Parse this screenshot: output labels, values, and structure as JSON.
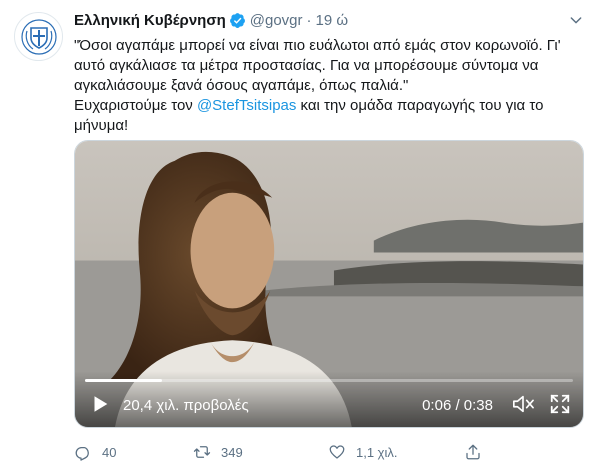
{
  "tweet": {
    "display_name": "Ελληνική Κυβέρνηση",
    "handle": "@govgr",
    "separator": "·",
    "time": "19 ώ",
    "text_before": "\"Όσοι αγαπάμε μπορεί να είναι πιο ευάλωτοι από εμάς στον κορωνοϊό. Γι' αυτό αγκάλιασε τα μέτρα προστασίας. Για να μπορέσουμε σύντομα να αγκαλιάσουμε ξανά όσους αγαπάμε, όπως παλιά.\"\nΕυχαριστούμε τον ",
    "mention": "@StefTsitsipas",
    "text_after": " και την ομάδα παραγωγής του για το μήνυμα!"
  },
  "video": {
    "views": "20,4 χιλ. προβολές",
    "time_readout": "0:06 / 0:38",
    "progress_fraction": 0.158
  },
  "actions": {
    "replies": "40",
    "retweets": "349",
    "likes": "1,1 χιλ."
  },
  "colors": {
    "accent": "#1b95e0",
    "verified": "#1da1f2",
    "muted": "#5b7083"
  },
  "icons": [
    "coat-of-arms-icon",
    "verified-icon",
    "chevron-down-icon",
    "play-icon",
    "mute-icon",
    "fullscreen-icon",
    "reply-icon",
    "retweet-icon",
    "like-icon",
    "share-icon"
  ]
}
